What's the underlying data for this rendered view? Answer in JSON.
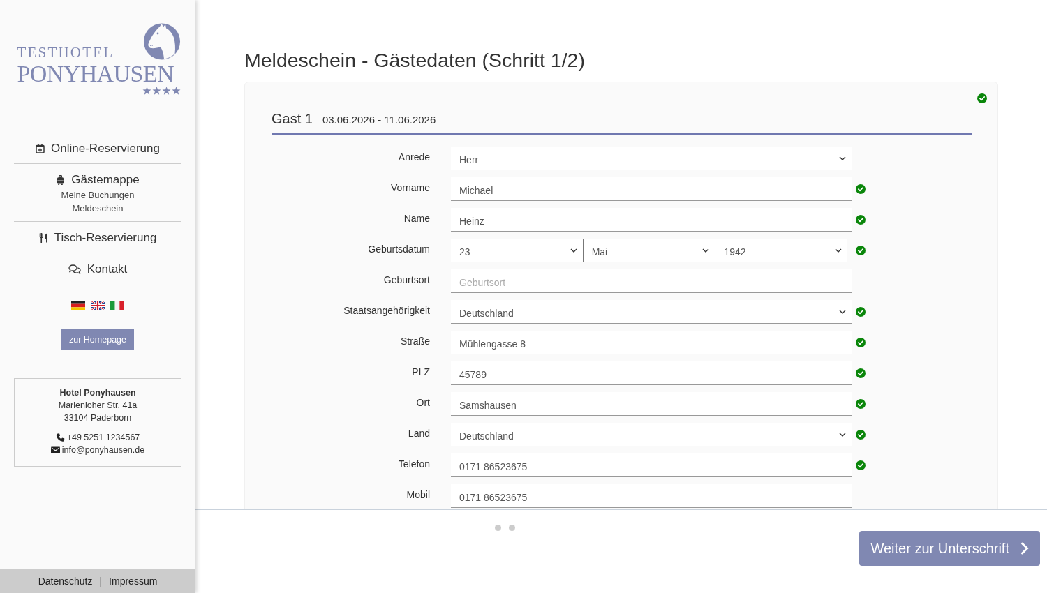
{
  "sidebar": {
    "logo": {
      "line_1": "TESTHOTEL",
      "line_2": "PONYHAUSEN",
      "stars": 4
    },
    "nav": [
      {
        "label": "Online-Reservierung"
      },
      {
        "label": "Gästemappe",
        "children": [
          {
            "label": "Meine Buchungen"
          },
          {
            "label": "Meldeschein"
          }
        ]
      },
      {
        "label": "Tisch-Reservierung"
      },
      {
        "label": "Kontakt"
      }
    ],
    "homepage_button": "zur Homepage",
    "contact": {
      "name": "Hotel Ponyhausen",
      "address_lines": [
        "Marienloher Str. 41a",
        "33104 Paderborn"
      ],
      "phone": "+49 5251 1234567",
      "email": "info@ponyhausen.de"
    },
    "footer": {
      "links": [
        "Datenschutz",
        "Impressum"
      ],
      "separator": "|"
    }
  },
  "main": {
    "title": "Meldeschein - Gästedaten (Schritt 1/2)",
    "guest": {
      "title": "Gast 1",
      "dates": "03.06.2026 - 11.06.2026",
      "complete": true,
      "fields": [
        {
          "label": "Anrede",
          "kind": "select",
          "value": "Herr",
          "valid": false
        },
        {
          "label": "Vorname",
          "kind": "text",
          "value": "Michael",
          "valid": true
        },
        {
          "label": "Name",
          "kind": "text",
          "value": "Heinz",
          "valid": true
        },
        {
          "label": "Geburtsdatum",
          "kind": "date",
          "parts": [
            "23",
            "Mai",
            "1942"
          ],
          "valid": true
        },
        {
          "label": "Geburtsort",
          "kind": "text",
          "placeholder": "Geburtsort",
          "valid": false
        },
        {
          "label": "Staatsangehörigkeit",
          "kind": "select",
          "value": "Deutschland",
          "valid": true
        },
        {
          "label": "Straße",
          "kind": "text",
          "value": "Mühlengasse 8",
          "valid": true
        },
        {
          "label": "PLZ",
          "kind": "text",
          "value": "45789",
          "valid": true
        },
        {
          "label": "Ort",
          "kind": "text",
          "value": "Samshausen",
          "valid": true
        },
        {
          "label": "Land",
          "kind": "select",
          "value": "Deutschland",
          "valid": true
        },
        {
          "label": "Telefon",
          "kind": "text",
          "value": "0171 86523675",
          "valid": true
        },
        {
          "label": "Mobil",
          "kind": "text",
          "value": "0171 86523675",
          "valid": false
        }
      ]
    },
    "step_dots": [
      {
        "selected": false
      },
      {
        "selected": false
      }
    ],
    "next_button": "Weiter zur Unterschrift"
  }
}
